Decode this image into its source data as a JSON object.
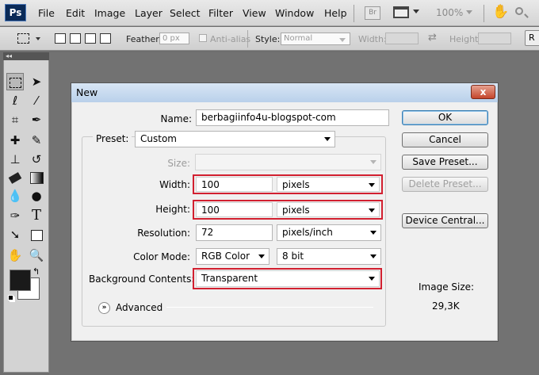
{
  "app": {
    "logo": "Ps"
  },
  "menu": {
    "items": [
      "File",
      "Edit",
      "Image",
      "Layer",
      "Select",
      "Filter",
      "View",
      "Window",
      "Help"
    ],
    "bridge_label": "Br",
    "zoom": "100%"
  },
  "options_bar": {
    "feather_label": "Feather:",
    "feather_value": "0 px",
    "antialias_label": "Anti-alias",
    "style_label": "Style:",
    "style_value": "Normal",
    "width_label": "Width:",
    "height_label": "Height:",
    "refine_label": "R"
  },
  "dialog": {
    "title": "New",
    "close_glyph": "x",
    "name_label": "Name:",
    "name_value": "berbagiinfo4u-blogspot-com",
    "preset_label": "Preset:",
    "preset_value": "Custom",
    "size_label": "Size:",
    "size_value": "",
    "width_label": "Width:",
    "width_value": "100",
    "width_unit": "pixels",
    "height_label": "Height:",
    "height_value": "100",
    "height_unit": "pixels",
    "resolution_label": "Resolution:",
    "resolution_value": "72",
    "resolution_unit": "pixels/inch",
    "color_mode_label": "Color Mode:",
    "color_mode_value": "RGB Color",
    "bit_depth_value": "8 bit",
    "background_label": "Background Contents:",
    "background_value": "Transparent",
    "advanced_label": "Advanced",
    "buttons": {
      "ok": "OK",
      "cancel": "Cancel",
      "save_preset": "Save Preset...",
      "delete_preset": "Delete Preset...",
      "device_central": "Device Central..."
    },
    "image_size_label": "Image Size:",
    "image_size_value": "29,3K"
  },
  "colors": {
    "highlight_red": "#d22030",
    "dialog_bg": "#f0f0f0",
    "workspace": "#6e6e6e"
  }
}
